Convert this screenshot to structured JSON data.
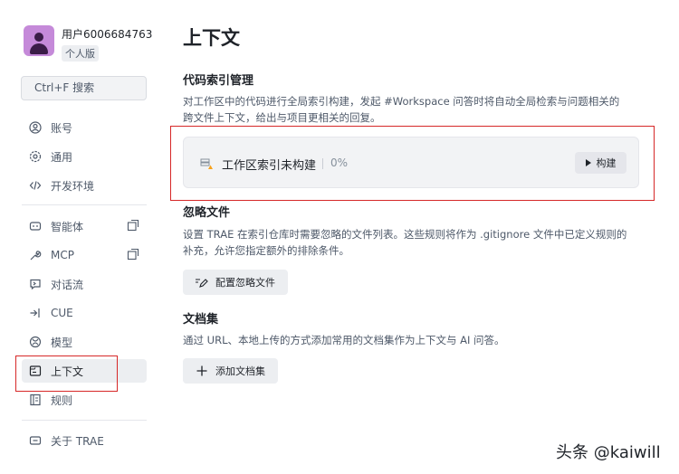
{
  "profile": {
    "username": "用户6006684763",
    "edition": "个人版"
  },
  "search": {
    "label": "Ctrl+F 搜索"
  },
  "sidebar": {
    "items": [
      {
        "label": "账号",
        "icon": "account-icon"
      },
      {
        "label": "通用",
        "icon": "gear-icon"
      },
      {
        "label": "开发环境",
        "icon": "code-icon"
      },
      {
        "label": "智能体",
        "icon": "agent-icon",
        "external": true
      },
      {
        "label": "MCP",
        "icon": "wrench-icon",
        "external": true
      },
      {
        "label": "对话流",
        "icon": "chat-icon"
      },
      {
        "label": "CUE",
        "icon": "cue-icon"
      },
      {
        "label": "模型",
        "icon": "model-icon"
      },
      {
        "label": "上下文",
        "icon": "context-icon",
        "active": true
      },
      {
        "label": "规则",
        "icon": "rules-icon"
      },
      {
        "label": "关于 TRAE",
        "icon": "about-icon"
      }
    ]
  },
  "main": {
    "title": "上下文",
    "code_index": {
      "title": "代码索引管理",
      "desc_line1": "对工作区中的代码进行全局索引构建，发起 #Workspace 问答时将自动全局检索与问题相关的",
      "desc_line2": "跨文件上下文，给出与项目更相关的回复。",
      "status": "工作区索引未构建",
      "progress": "0%",
      "build_label": "构建"
    },
    "ignore_files": {
      "title": "忽略文件",
      "desc_line1": "设置 TRAE 在索引仓库时需要忽略的文件列表。这些规则将作为 .gitignore 文件中已定义规则的",
      "desc_line2": "补充，允许您指定额外的排除条件。",
      "button_label": "配置忽略文件"
    },
    "docs": {
      "title": "文档集",
      "desc": "通过 URL、本地上传的方式添加常用的文档集作为上下文与 AI 问答。",
      "button_label": "添加文档集"
    }
  },
  "watermark": "头条 @kaiwill",
  "colors": {
    "highlight_box": "#d62828",
    "active_bg": "#eceef1",
    "avatar": "#c58ad9"
  }
}
